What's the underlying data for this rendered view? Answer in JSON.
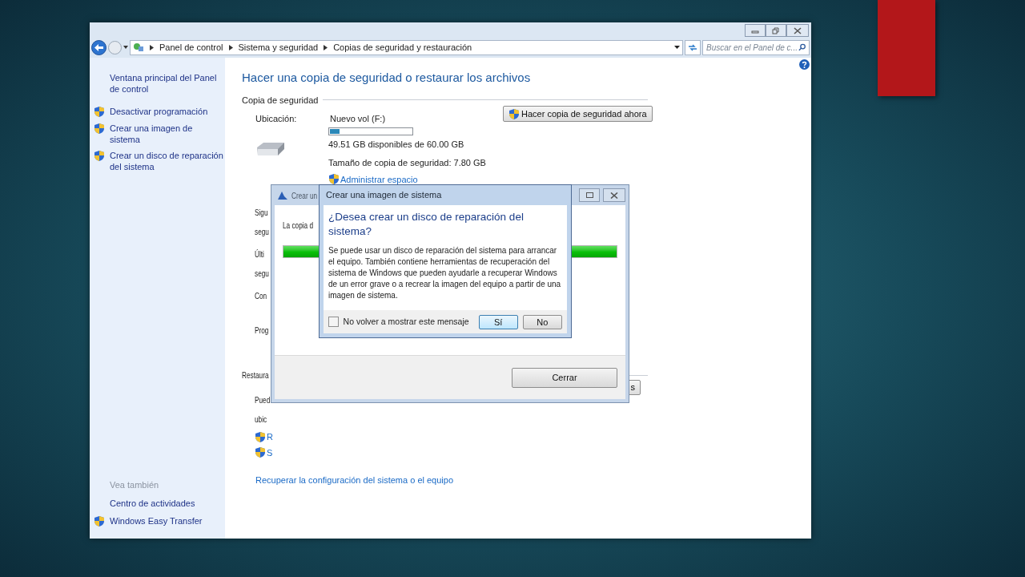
{
  "window": {
    "breadcrumb": [
      "Panel de control",
      "Sistema y seguridad",
      "Copias de seguridad y restauración"
    ],
    "search": {
      "placeholder": "Buscar en el Panel de c..."
    }
  },
  "sidebar": {
    "items": [
      {
        "label": "Ventana principal del Panel de control",
        "shield": false
      },
      {
        "label": "Desactivar programación",
        "shield": true
      },
      {
        "label": "Crear una imagen de sistema",
        "shield": true
      },
      {
        "label": "Crear un disco de reparación del sistema",
        "shield": true
      }
    ],
    "see_also": {
      "title": "Vea también",
      "items": [
        {
          "label": "Centro de actividades",
          "shield": false
        },
        {
          "label": "Windows Easy Transfer",
          "shield": true
        }
      ]
    }
  },
  "content": {
    "title": "Hacer una copia de seguridad o restaurar los archivos",
    "backup": {
      "section": "Copia de seguridad",
      "location_label": "Ubicación:",
      "location": "Nuevo vol (F:)",
      "level": 0.12,
      "available": "49.51 GB disponibles de 60.00 GB",
      "size": "Tamaño de copia de seguridad: 7.80 GB",
      "manage_link": "Administrar espacio",
      "button": "Hacer copia de seguridad ahora",
      "cut_groups": [
        [
          "Sigu",
          "segu"
        ],
        [
          "Últi",
          "segu"
        ],
        [
          "Con"
        ],
        [
          "Prog"
        ]
      ]
    },
    "restore": {
      "section": "Restaura",
      "lines": [
        "Pued",
        "ubic"
      ],
      "links": [
        "R",
        "S"
      ],
      "button": "s"
    },
    "recover_link": "Recuperar la configuración del sistema o el equipo"
  },
  "progress_dialog": {
    "title": "Crear un",
    "text": "La copia d",
    "level": 1,
    "close_button": "Cerrar"
  },
  "prompt": {
    "title": "Crear una imagen de sistema",
    "heading": "¿Desea crear un disco de reparación del sistema?",
    "body": "Se puede usar un disco de reparación del sistema para arrancar el equipo. También contiene herramientas de recuperación del sistema de Windows que pueden ayudarle a recuperar Windows de un error grave o a recrear la imagen del equipo a partir de una imagen de sistema.",
    "checkbox": {
      "label": "No volver a mostrar este mensaje",
      "checked": false
    },
    "buttons": [
      {
        "label": "Sí",
        "default": true
      },
      {
        "label": "No",
        "default": false
      }
    ]
  }
}
